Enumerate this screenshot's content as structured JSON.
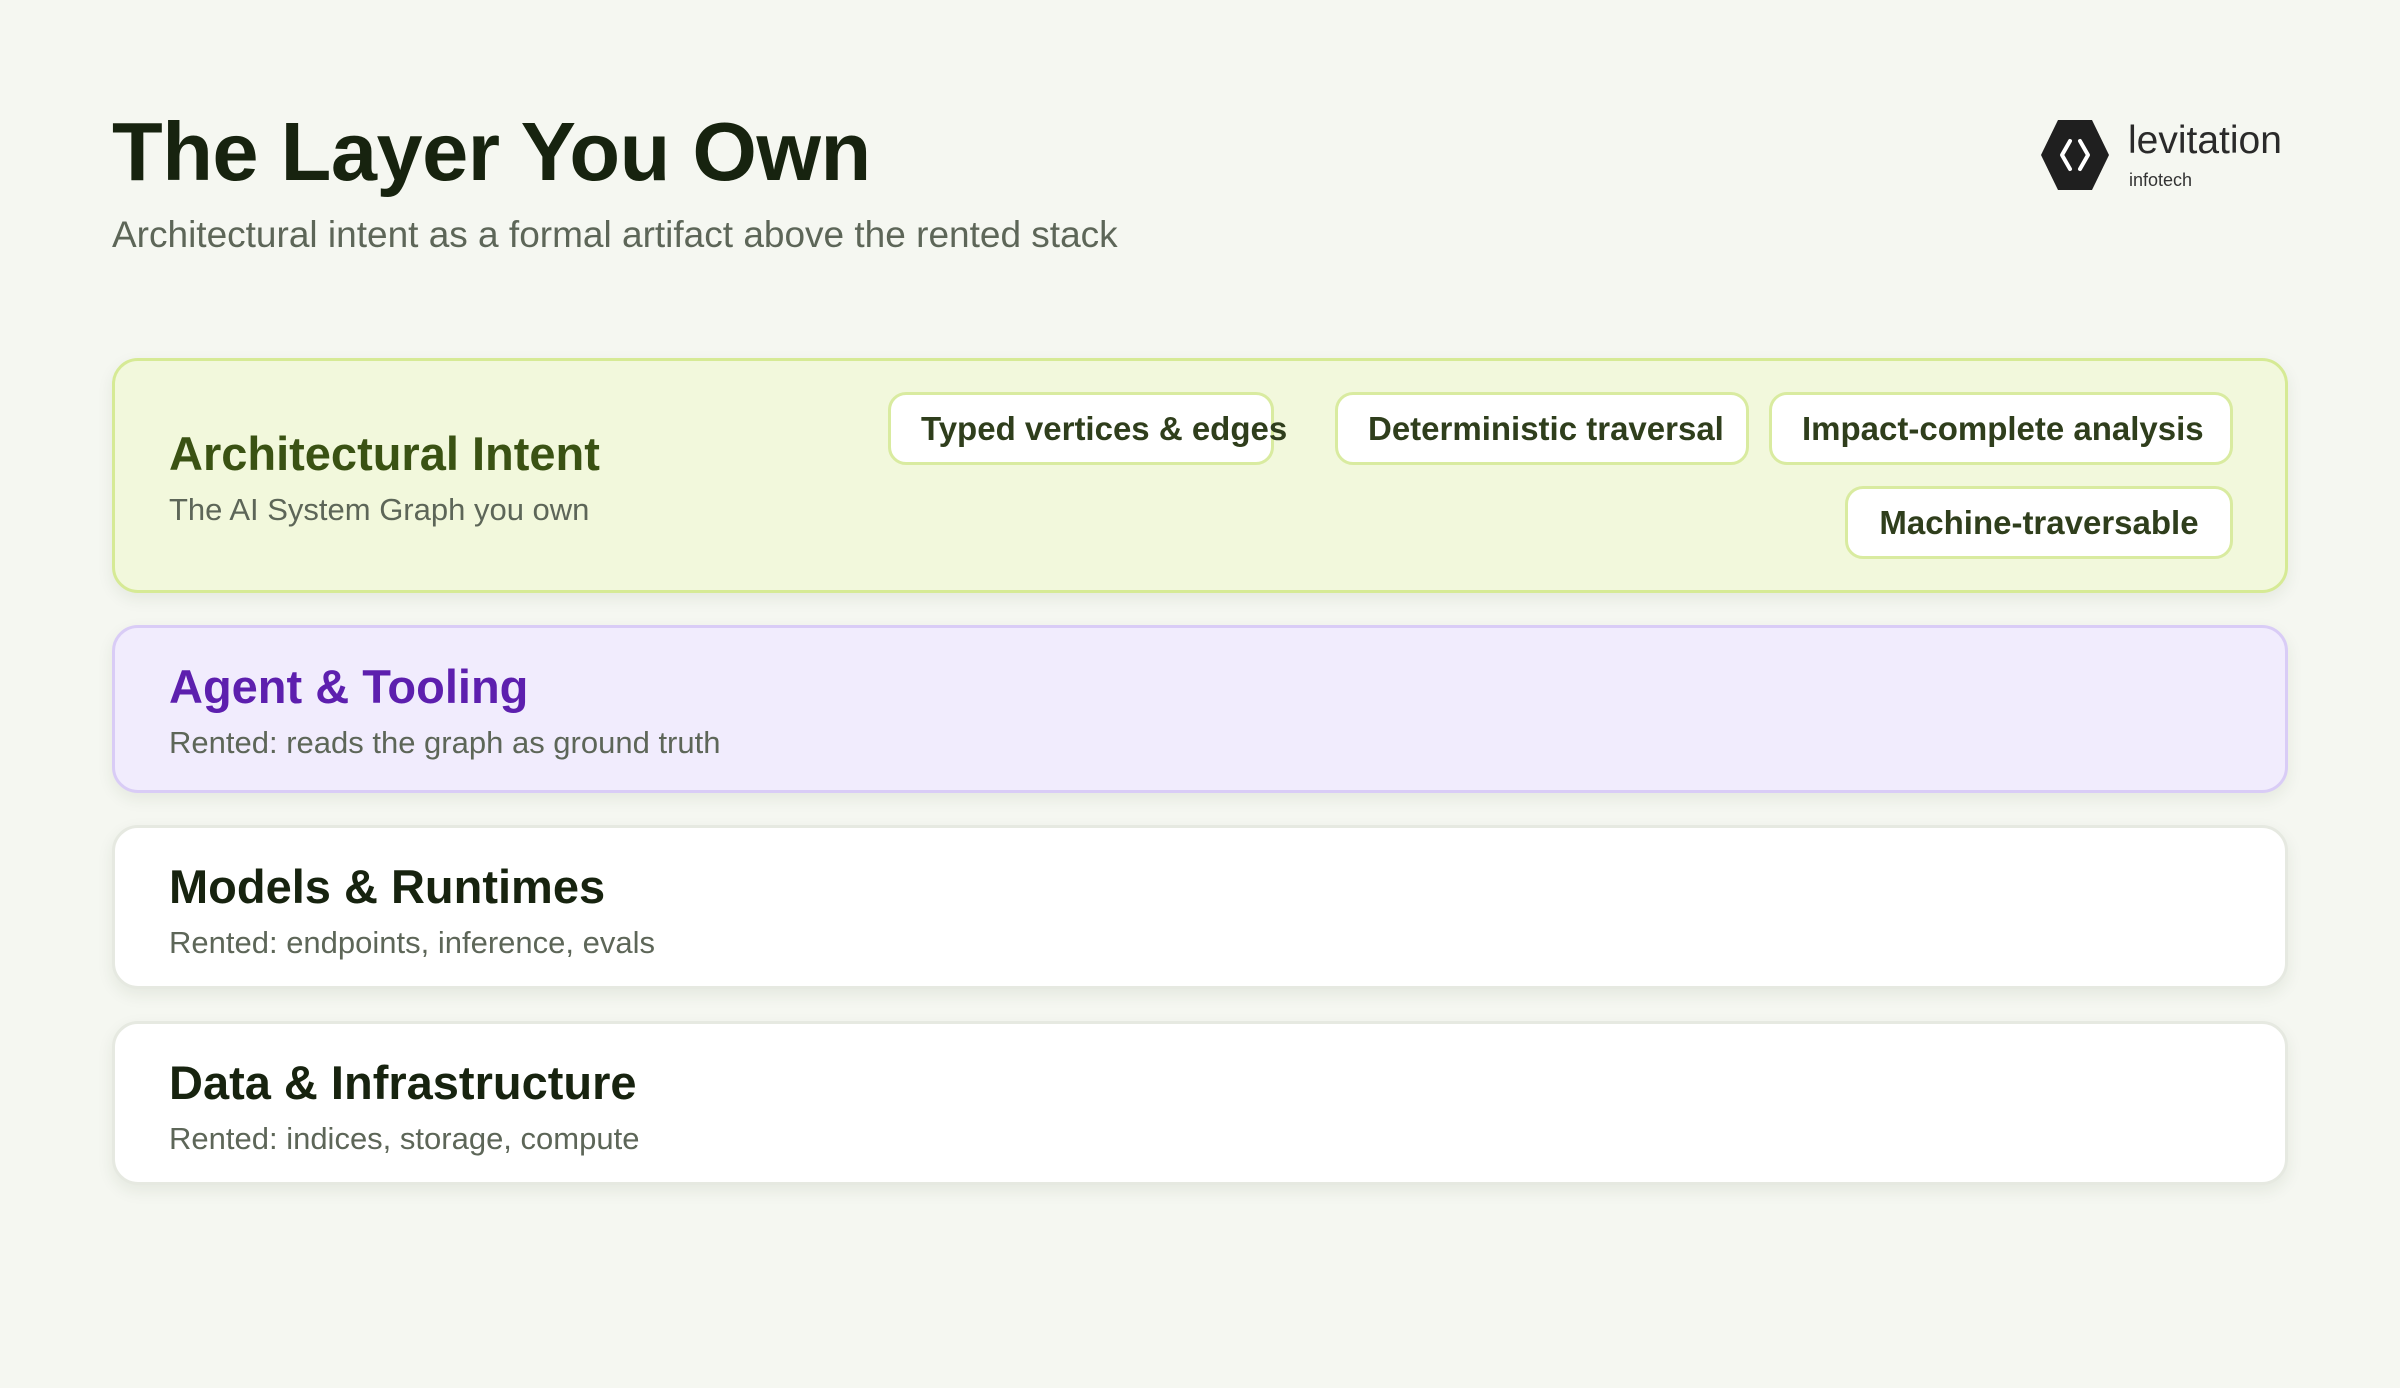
{
  "header": {
    "title": "The Layer You Own",
    "subtitle": "Architectural intent as a formal artifact above the rented stack"
  },
  "logo": {
    "icon": "hexagon-code-icon",
    "name": "levitation",
    "tagline": "infotech"
  },
  "layers": [
    {
      "title": "Architectural Intent",
      "description": "The AI System Graph you own",
      "chips": [
        "Typed vertices & edges",
        "Deterministic traversal",
        "Impact-complete analysis",
        "Machine-traversable"
      ]
    },
    {
      "title": "Agent & Tooling",
      "description": "Rented: reads the graph as ground truth"
    },
    {
      "title": "Models & Runtimes",
      "description": "Rented: endpoints, inference, evals"
    },
    {
      "title": "Data & Infrastructure",
      "description": "Rented: indices, storage, compute"
    }
  ],
  "colors": {
    "background": "#f5f7f1",
    "intent_fill": "#f2f8dc",
    "intent_border": "#d6ea95",
    "intent_title": "#3a5213",
    "agent_fill": "#f1ecfd",
    "agent_border": "#d9ccf6",
    "agent_title": "#5d1fae",
    "rented_fill": "#ffffff",
    "heading": "#17230f"
  }
}
